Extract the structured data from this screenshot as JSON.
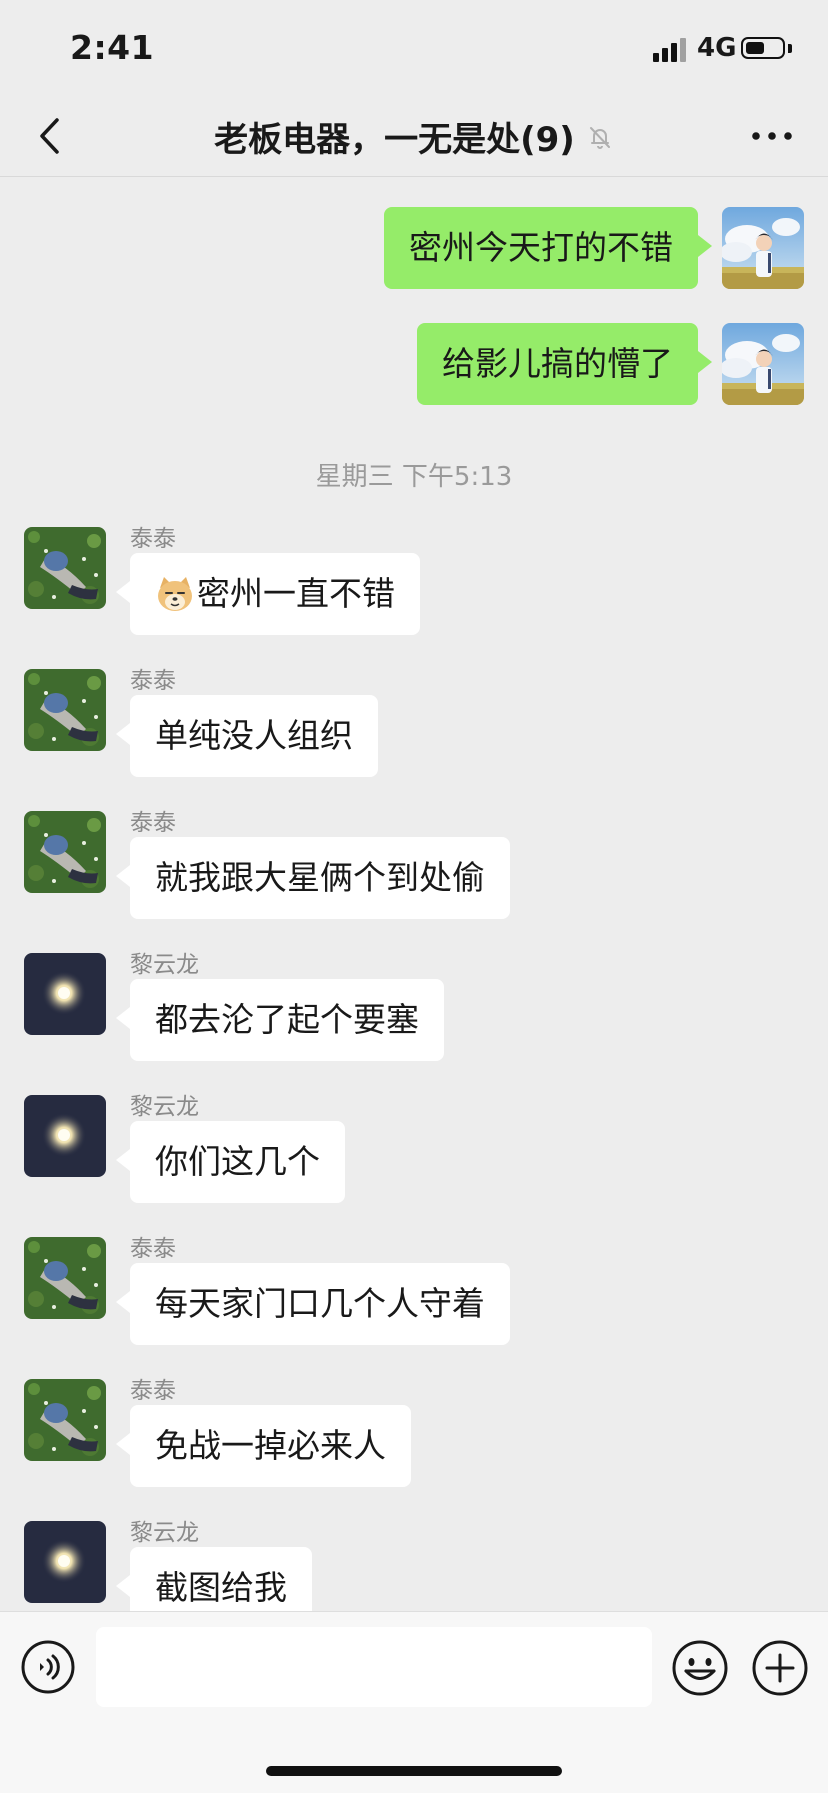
{
  "status_bar": {
    "time": "2:41",
    "network": "4G",
    "battery_level": 0.45
  },
  "nav": {
    "title": "老板电器，一无是处(9)"
  },
  "messages": {
    "m1": {
      "text": "密州今天打的不错"
    },
    "m2": {
      "text": "给影儿搞的懵了"
    },
    "timestamp": "星期三 下午5:13",
    "m3": {
      "sender": "泰泰",
      "text": "密州一直不错",
      "emoji": "doge-emoji"
    },
    "m4": {
      "sender": "泰泰",
      "text": "单纯没人组织"
    },
    "m5": {
      "sender": "泰泰",
      "text": "就我跟大星俩个到处偷"
    },
    "m6": {
      "sender": "黎云龙",
      "text": "都去沦了起个要塞"
    },
    "m7": {
      "sender": "黎云龙",
      "text": "你们这几个"
    },
    "m8": {
      "sender": "泰泰",
      "text": "每天家门口几个人守着"
    },
    "m9": {
      "sender": "泰泰",
      "text": "免战一掉必来人"
    },
    "m10": {
      "sender": "黎云龙",
      "text": "截图给我"
    }
  },
  "input": {
    "value": "",
    "placeholder": ""
  },
  "colors": {
    "background": "#ededed",
    "outgoing_bubble": "#95ec69",
    "incoming_bubble": "#ffffff",
    "meta_text": "#8a8a8a"
  },
  "icons": [
    "back-arrow-icon",
    "mute-bell-icon",
    "more-dots-icon",
    "voice-icon",
    "emoji-icon",
    "plus-icon"
  ]
}
